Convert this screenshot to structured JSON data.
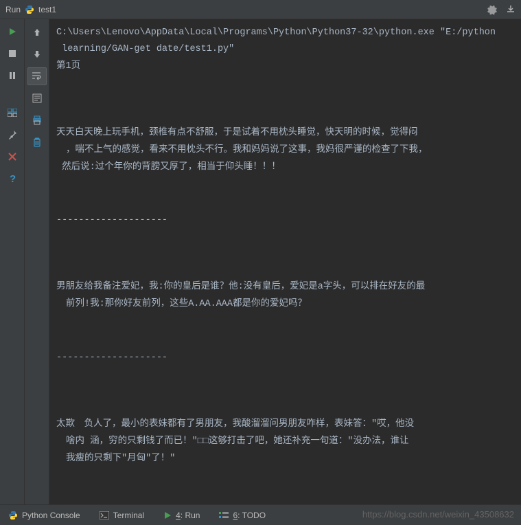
{
  "header": {
    "run_label": "Run",
    "script_name": "test1"
  },
  "console": {
    "exec_line": "C:\\Users\\Lenovo\\AppData\\Local\\Programs\\Python\\Python37-32\\python.exe \"E:/python",
    "exec_line2": " learning/GAN-get date/test1.py\"",
    "page_label": "第1页",
    "story1_line1": "天天白天晚上玩手机，颈椎有点不舒服，于是试着不用枕头睡觉，快天明的时候，觉得闷",
    "story1_line2": "，喘不上气的感觉，看来不用枕头不行。我和妈妈说了这事，我妈很严谨的检查了下我，",
    "story1_line3": " 然后说:过个年你的背膀又厚了，相当于仰头睡！！！",
    "divider": "--------------------",
    "story2_line1": "男朋友给我备注爱妃，我:你的皇后是谁？他:没有皇后，爱妃是a字头，可以排在好友的最",
    "story2_line2": "前列!我:那你好友前列，这些A.AA.AAA都是你的爱妃吗？",
    "story3_line1": "太欺　负人了，最小的表妹都有了男朋友，我酸溜溜问男朋友咋样，表妹答：\"哎，他没",
    "story3_line2": "啥内 涵，穷的只剩钱了而已！\"□□这够打击了吧，她还补充一句道：\"没办法，谁让",
    "story3_line3": "我瘦的只剩下\"月匈\"了！\""
  },
  "bottom_tabs": {
    "python_console": "Python Console",
    "terminal": "Terminal",
    "run_num": "4",
    "run_label": ": Run",
    "todo_num": "6",
    "todo_label": ": TODO"
  },
  "watermark": "https://blog.csdn.net/weixin_43508632"
}
